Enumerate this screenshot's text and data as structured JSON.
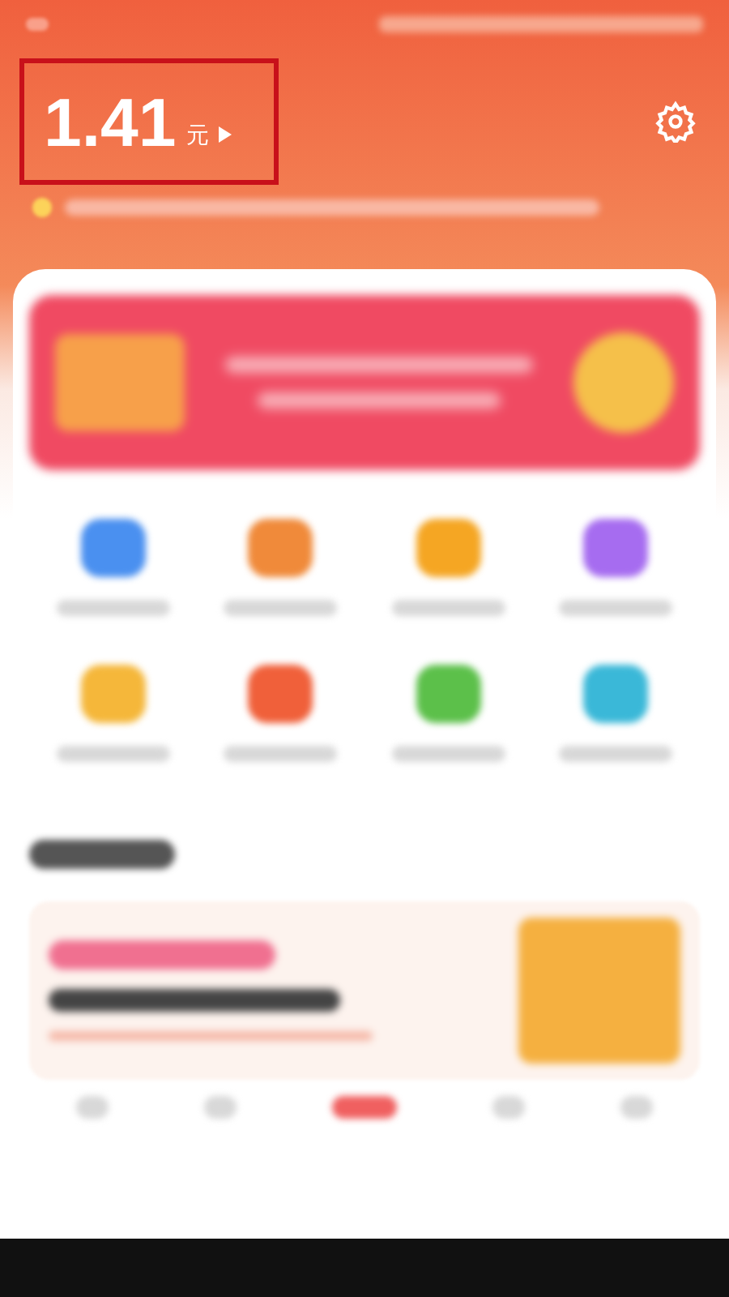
{
  "balance": {
    "amount": "1.41",
    "unit": "元"
  },
  "shortcuts": [
    {
      "color": "#4a90f0"
    },
    {
      "color": "#f08a3a"
    },
    {
      "color": "#f5a623"
    },
    {
      "color": "#a66cf0"
    },
    {
      "color": "#f5b73a"
    },
    {
      "color": "#f0603a"
    },
    {
      "color": "#5cc04a"
    },
    {
      "color": "#3ab8d8"
    }
  ]
}
